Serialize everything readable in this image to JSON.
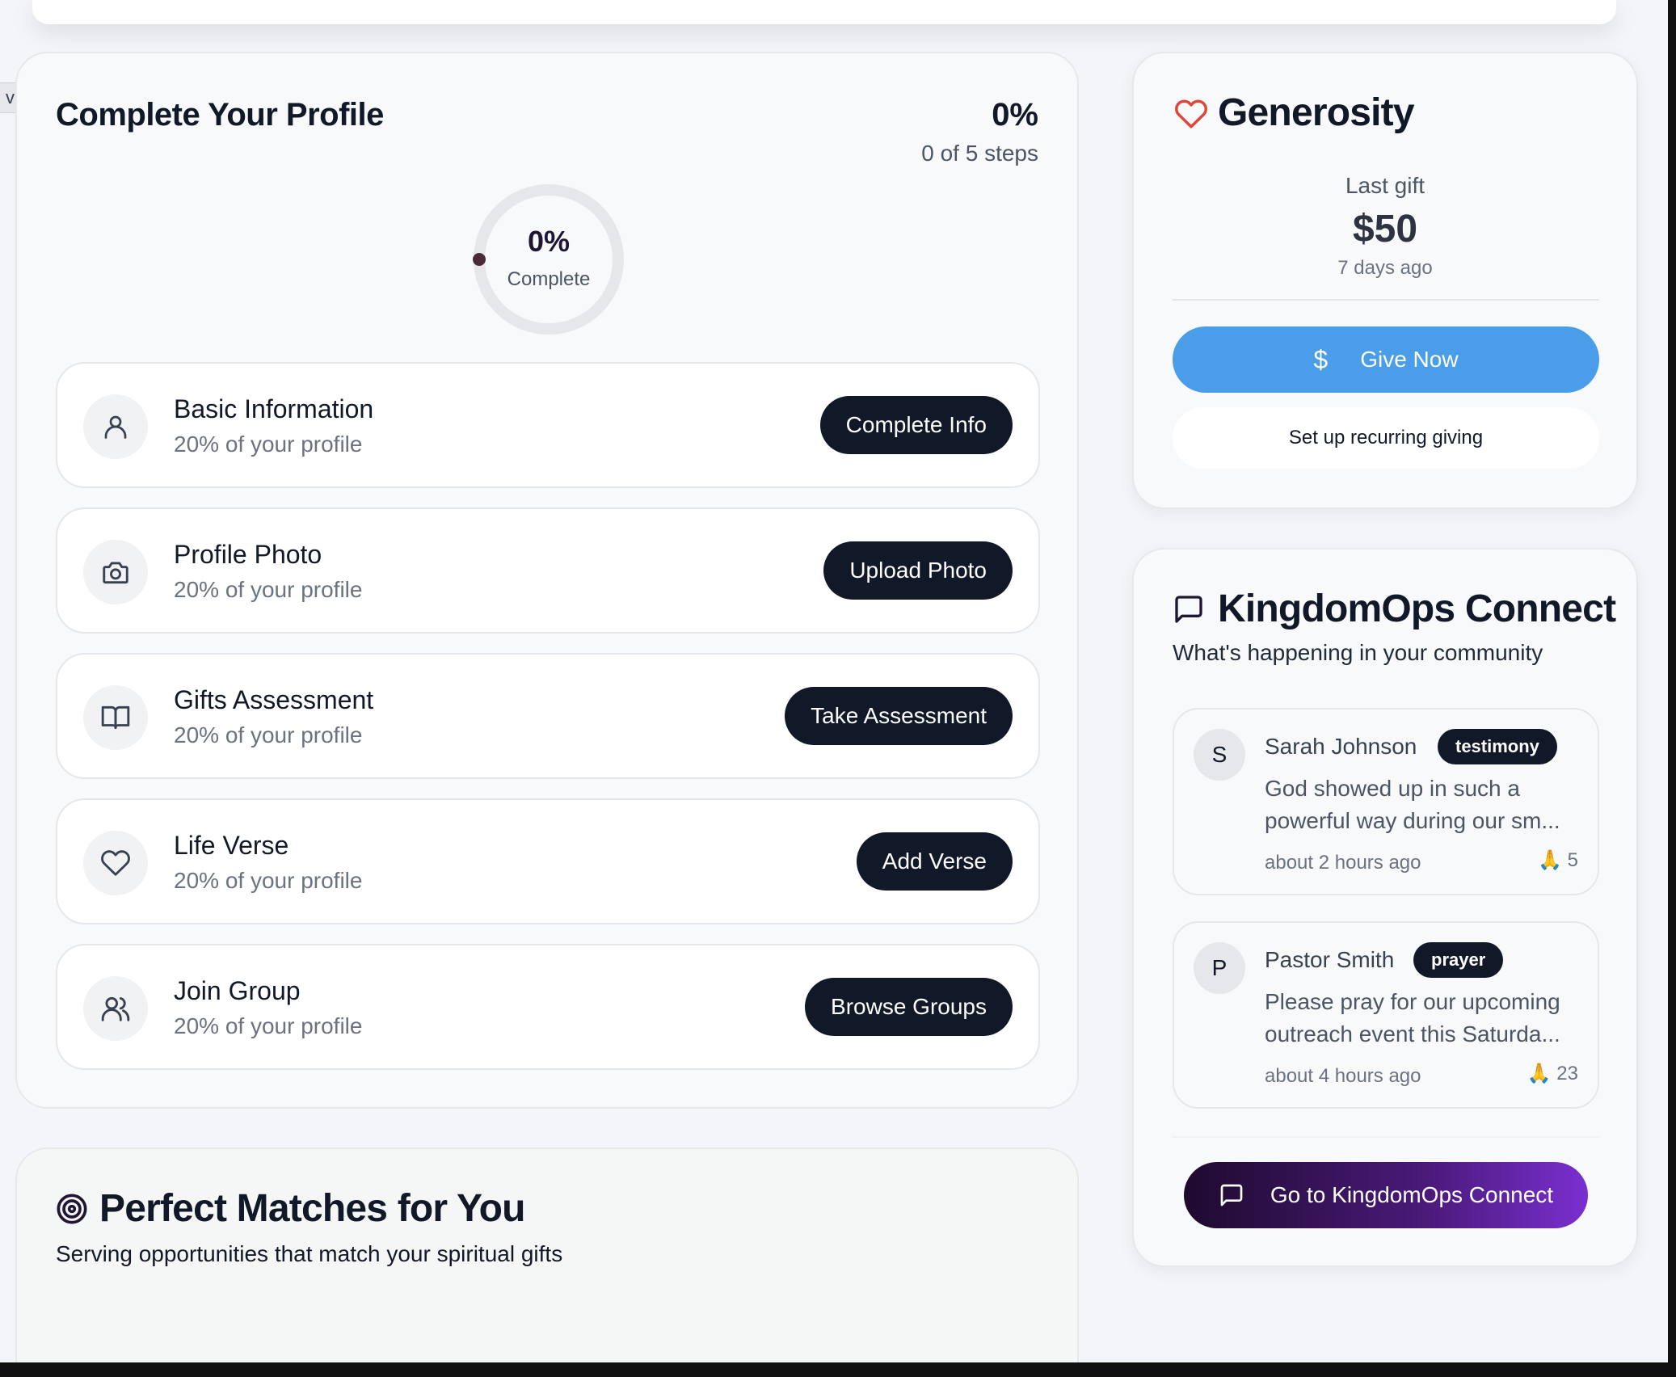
{
  "view_tab": "view",
  "profile": {
    "title": "Complete Your Profile",
    "percent": "0%",
    "steps_text": "0 of 5 steps",
    "progress_fraction": 0,
    "ring_percent": "0%",
    "ring_label": "Complete",
    "steps": [
      {
        "title": "Basic Information",
        "sub": "20% of your profile",
        "button": "Complete Info",
        "icon": "user-icon"
      },
      {
        "title": "Profile Photo",
        "sub": "20% of your profile",
        "button": "Upload Photo",
        "icon": "camera-icon"
      },
      {
        "title": "Gifts Assessment",
        "sub": "20% of your profile",
        "button": "Take Assessment",
        "icon": "book-icon"
      },
      {
        "title": "Life Verse",
        "sub": "20% of your profile",
        "button": "Add Verse",
        "icon": "heart-icon"
      },
      {
        "title": "Join Group",
        "sub": "20% of your profile",
        "button": "Browse Groups",
        "icon": "users-icon"
      }
    ]
  },
  "matches": {
    "title": "Perfect Matches for You",
    "subtitle": "Serving opportunities that match your spiritual gifts",
    "icon": "target-icon"
  },
  "generosity": {
    "title": "Generosity",
    "icon": "heart-icon",
    "last_gift_label": "Last gift",
    "last_gift_amount": "$50",
    "last_gift_time": "7 days ago",
    "give_icon": "$",
    "give_label": "Give Now",
    "recurring_label": "Set up recurring giving",
    "colors": {
      "give_button": "#4a9de8",
      "heart": "#e0453a"
    }
  },
  "connect": {
    "title": "KingdomOps Connect",
    "subtitle": "What's happening in your community",
    "icon": "message-square-icon",
    "posts": [
      {
        "initial": "S",
        "author": "Sarah Johnson",
        "tag": "testimony",
        "body": "God showed up in such a powerful way during our sm...",
        "time": "about 2 hours ago",
        "reaction": "🙏",
        "count": "5"
      },
      {
        "initial": "P",
        "author": "Pastor Smith",
        "tag": "prayer",
        "body": "Please pray for our upcoming outreach event this Saturda...",
        "time": "about 4 hours ago",
        "reaction": "🙏",
        "count": "23"
      }
    ],
    "go_label": "Go to KingdomOps Connect"
  }
}
